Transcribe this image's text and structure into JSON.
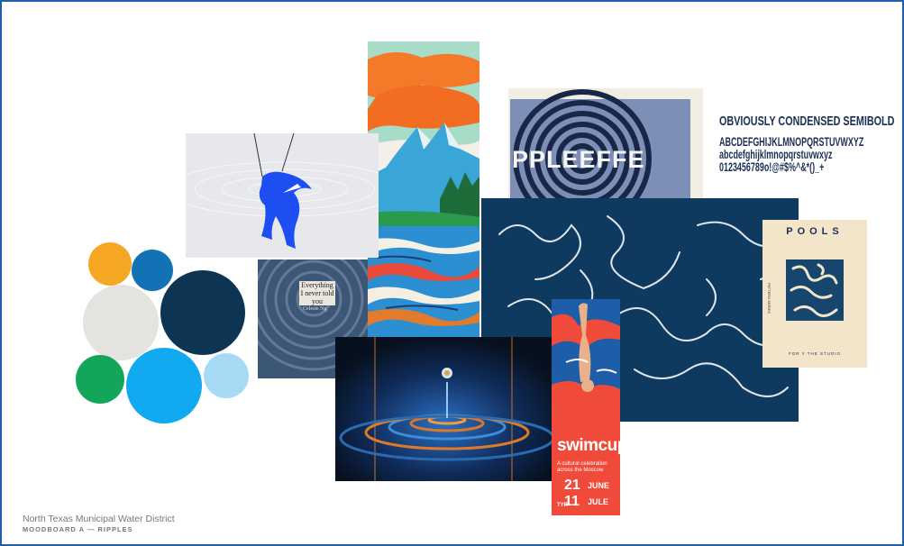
{
  "footer": {
    "organization": "North Texas Municipal Water District",
    "moodboard": "MOODBOARD A — RIPPLES"
  },
  "typeface": {
    "name": "OBVIOUSLY CONDENSED SEMIBOLD",
    "uppercase": "ABCDEFGHIJKLMNOPQRSTUVWXYZ",
    "lowercase": "abcdefghijklmnopqrstuvwxyz",
    "numerals": "0123456789o!@#$%^&*()_+"
  },
  "palette": [
    "#f5a623",
    "#1272b6",
    "#e4e3df",
    "#0d3453",
    "#13a65b",
    "#11a9f0",
    "#a6daf5"
  ],
  "tiles": {
    "ripple_text": "PPLEEFFE",
    "quote": "Everything I never told you",
    "quote_author": "Celeste Ng",
    "pools_title": "POOLS",
    "pools_side": "PATTERN SERIES",
    "pools_footer": "FOR Y THE STUDIO",
    "swimcup_title": "swimcup",
    "swimcup_sub": "A cultural celebration across the Moscow",
    "swimcup_date1_num": "21",
    "swimcup_date1_month": "JUNE",
    "swimcup_date2_num": "11",
    "swimcup_date2_month": "JULE",
    "swimcup_brand": "TYR"
  }
}
